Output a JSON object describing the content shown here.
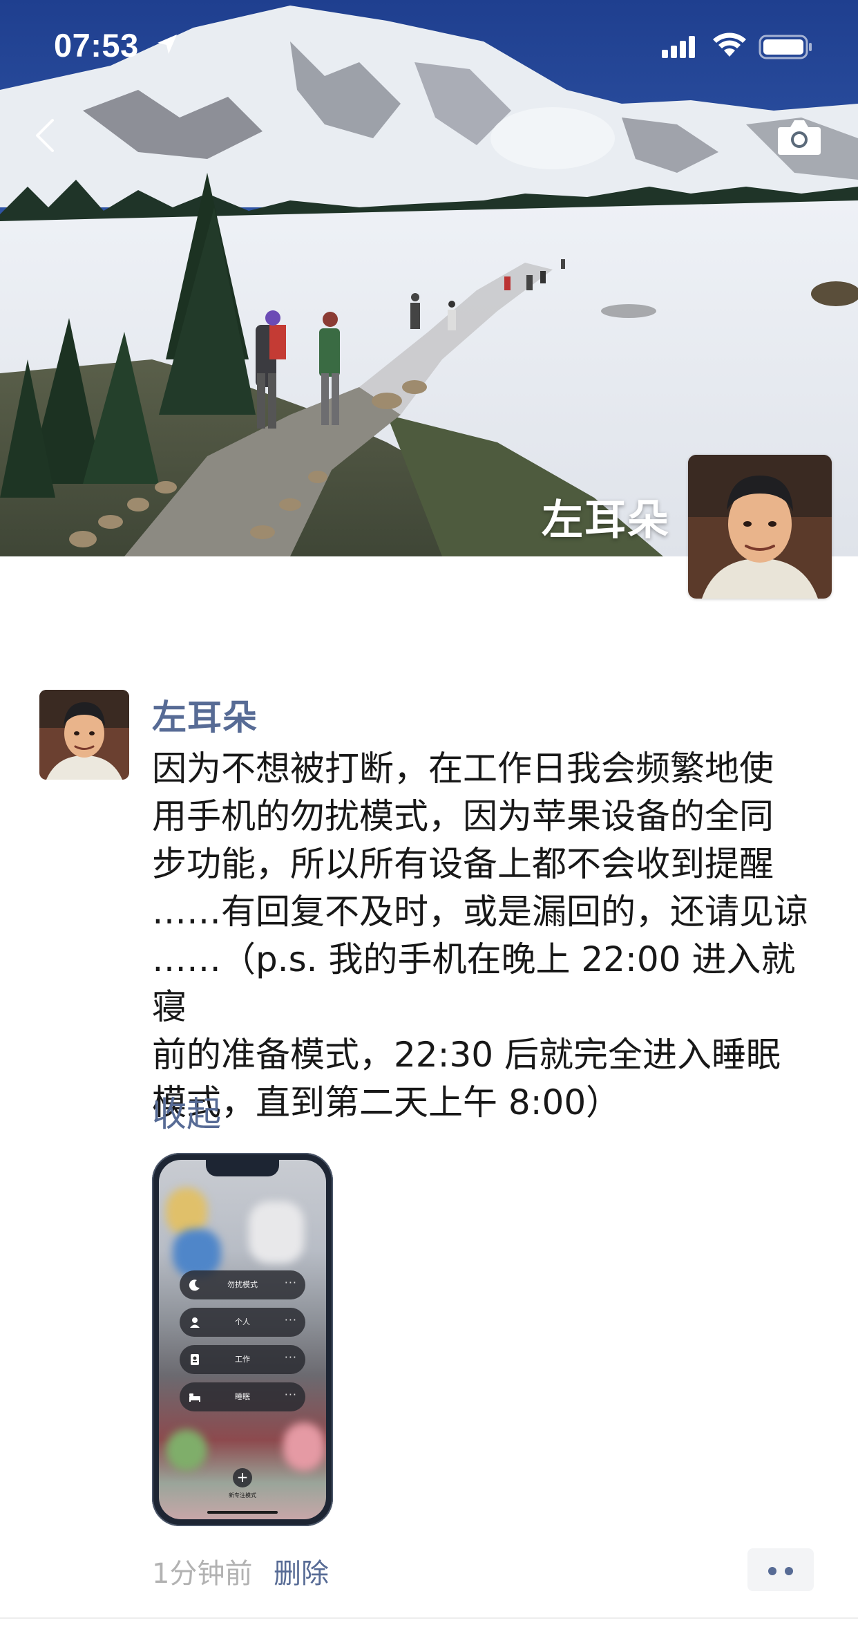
{
  "status_bar": {
    "time": "07:53",
    "icons": [
      "location-arrow-icon",
      "cellular-signal-icon",
      "wifi-icon",
      "battery-icon"
    ]
  },
  "header": {
    "back_icon": "chevron-left-icon",
    "camera_icon": "camera-icon",
    "cover_image": "snowy-mountain-trail-photo",
    "user_name": "左耳朵"
  },
  "post": {
    "author": "左耳朵",
    "text": "因为不想被打断，在工作日我会频繁地使\n用手机的勿扰模式，因为苹果设备的全同\n步功能，所以所有设备上都不会收到提醒\n……有回复不及时，或是漏回的，还请见谅\n……（p.s. 我的手机在晚上 22:00 进入就寝\n前的准备模式，22:30 后就完全进入睡眠\n模式，直到第二天上午 8:00）",
    "collapse_label": "收起",
    "image": {
      "description": "iphone-focus-modes-screenshot",
      "focus_modes": [
        {
          "label": "勿扰模式",
          "icon": "moon-icon"
        },
        {
          "label": "个人",
          "icon": "person-icon"
        },
        {
          "label": "工作",
          "icon": "badge-icon"
        },
        {
          "label": "睡眠",
          "icon": "bed-icon"
        }
      ],
      "more_glyph": "···",
      "new_focus_glyph": "+",
      "new_focus_label": "新专注模式"
    },
    "time_ago": "1分钟前",
    "delete_label": "删除",
    "more_icon": "more-dots-icon"
  },
  "colors": {
    "link": "#576b95",
    "text": "#181818",
    "muted": "#b2b2b2"
  }
}
